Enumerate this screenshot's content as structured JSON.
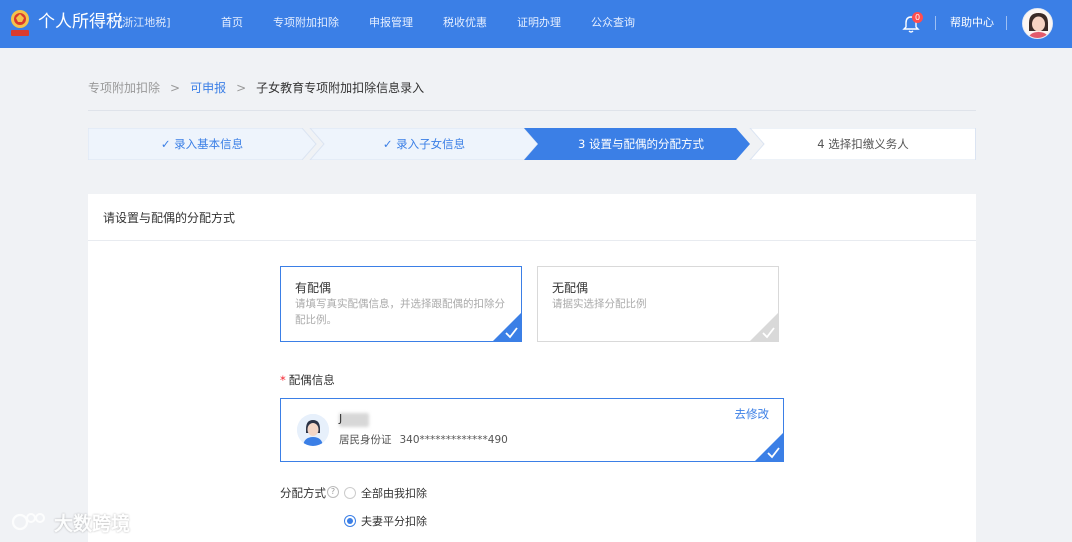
{
  "header": {
    "app_title": "个人所得税",
    "region": "[浙江地税]",
    "nav": [
      "首页",
      "专项附加扣除",
      "申报管理",
      "税收优惠",
      "证明办理",
      "公众查询"
    ],
    "notification_count": "0",
    "help_label": "帮助中心",
    "brand_color": "#3b7fe6"
  },
  "breadcrumb": {
    "root": "专项附加扣除",
    "link": "可申报",
    "current": "子女教育专项附加扣除信息录入",
    "separator": ">"
  },
  "steps": [
    {
      "label": "✓ 录入基本信息",
      "state": "done"
    },
    {
      "label": "✓ 录入子女信息",
      "state": "done"
    },
    {
      "label": "3 设置与配偶的分配方式",
      "state": "active"
    },
    {
      "label": "4 选择扣缴义务人",
      "state": "pending"
    }
  ],
  "card": {
    "title": "请设置与配偶的分配方式",
    "options": [
      {
        "title": "有配偶",
        "desc": "请填写真实配偶信息，并选择跟配偶的扣除分配比例。",
        "selected": true
      },
      {
        "title": "无配偶",
        "desc": "请据实选择分配比例",
        "selected": false
      }
    ],
    "spouse_section_label": "配偶信息",
    "required_mark": "*",
    "spouse": {
      "name_first_char": "J",
      "id_type": "居民身份证",
      "id_number": "340*************490",
      "edit_label": "去修改"
    },
    "allocation": {
      "label": "分配方式",
      "help_glyph": "?",
      "options": [
        {
          "label": "全部由我扣除",
          "selected": false
        },
        {
          "label": "夫妻平分扣除",
          "selected": true
        }
      ]
    }
  },
  "watermark": {
    "text": "大数跨境"
  }
}
